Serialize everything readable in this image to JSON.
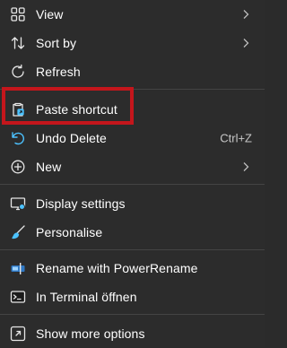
{
  "context_menu": {
    "items": [
      {
        "label": "View",
        "icon": "view-grid-icon",
        "has_submenu": true
      },
      {
        "label": "Sort by",
        "icon": "sort-icon",
        "has_submenu": true
      },
      {
        "label": "Refresh",
        "icon": "refresh-icon",
        "has_submenu": false
      },
      {
        "label": "Paste shortcut",
        "icon": "paste-shortcut-icon",
        "has_submenu": false
      },
      {
        "label": "Undo Delete",
        "icon": "undo-icon",
        "shortcut": "Ctrl+Z",
        "has_submenu": false
      },
      {
        "label": "New",
        "icon": "new-icon",
        "has_submenu": true
      },
      {
        "label": "Display settings",
        "icon": "display-icon",
        "has_submenu": false
      },
      {
        "label": "Personalise",
        "icon": "brush-icon",
        "has_submenu": false
      },
      {
        "label": "Rename with PowerRename",
        "icon": "powerrename-icon",
        "has_submenu": false
      },
      {
        "label": "In Terminal öffnen",
        "icon": "terminal-icon",
        "has_submenu": false
      },
      {
        "label": "Show more options",
        "icon": "more-options-icon",
        "has_submenu": false
      }
    ],
    "highlighted_item": "Paste shortcut"
  },
  "colors": {
    "background": "#2c2c2c",
    "text": "#ffffff",
    "separator": "#444444",
    "highlight_border": "#c4161c",
    "accent_blue": "#4cc2ff"
  }
}
